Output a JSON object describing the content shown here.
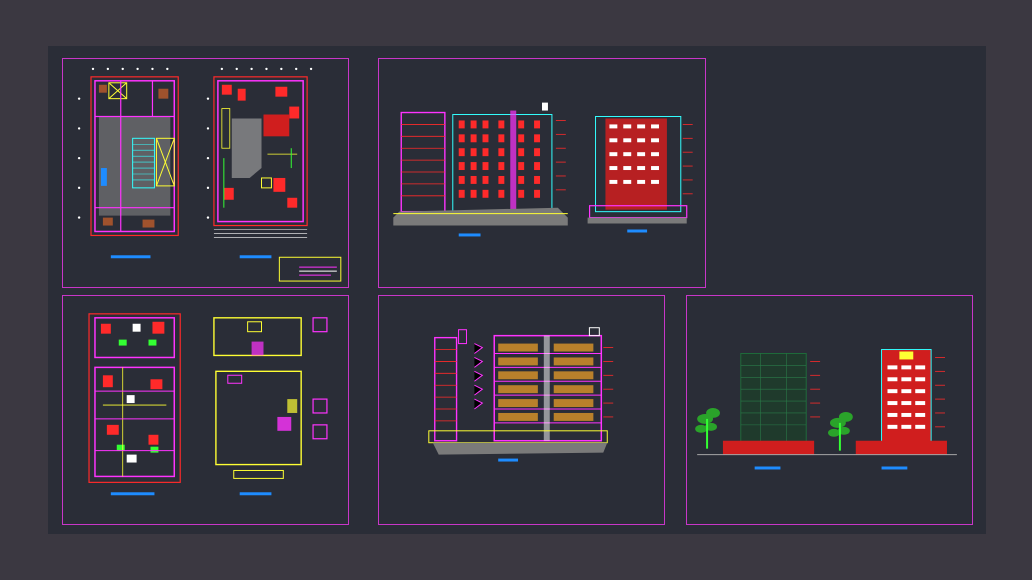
{
  "colors": {
    "background": "#3b3841",
    "model_space": "#2a2d37",
    "sheet_border": "#c836c8",
    "wall": "#ff33ff",
    "red": "#ff2a2a",
    "yellow": "#ffff33",
    "cyan": "#33ffff",
    "green": "#33ff33",
    "blue": "#1e8cff",
    "white": "#ffffff",
    "grey": "#a6a6a6"
  },
  "sheets": [
    {
      "id": "floor-plans-upper",
      "content": "floor-plans"
    },
    {
      "id": "elevations-pair",
      "content": "building-elevations"
    },
    {
      "id": "floor-plans-lower",
      "content": "floor-plans"
    },
    {
      "id": "building-section",
      "content": "section"
    },
    {
      "id": "exterior-elevations",
      "content": "elevations-with-trees"
    }
  ]
}
